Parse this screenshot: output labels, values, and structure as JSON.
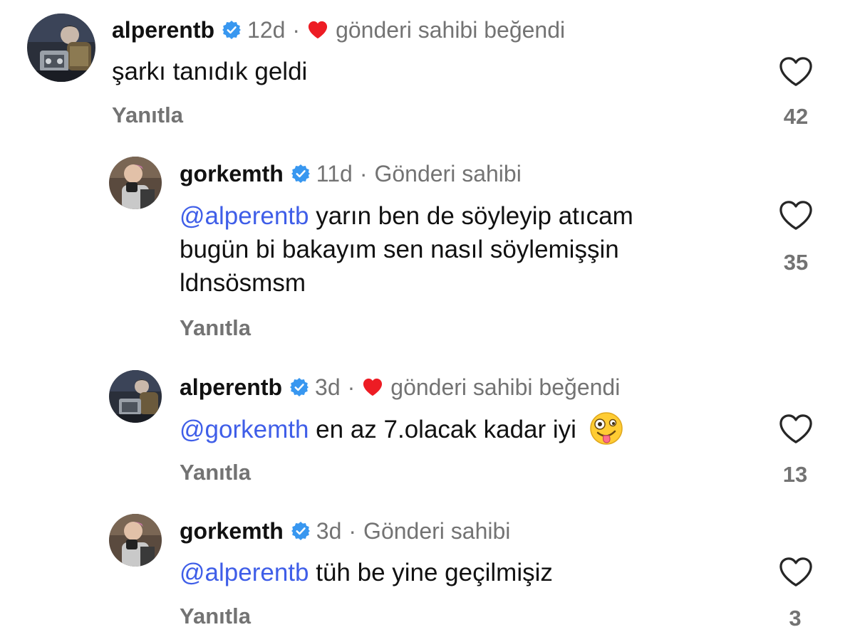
{
  "comments": [
    {
      "username": "alperentb",
      "time": "12d",
      "tag": "gönderi sahibi beğendi",
      "mention": "",
      "text": "şarkı tanıdık geldi",
      "reply": "Yanıtla",
      "likes": "42"
    },
    {
      "username": "gorkemth",
      "time": "11d",
      "tag": "Gönderi sahibi",
      "mention": "@alperentb",
      "line1": "yarın ben de söyleyip atıcam",
      "line2": "bugün bi bakayım sen nasıl söylemişşin",
      "line3": "ldnsösmsm",
      "reply": "Yanıtla",
      "likes": "35"
    },
    {
      "username": "alperentb",
      "time": "3d",
      "tag": "gönderi sahibi beğendi",
      "mention": "@gorkemth",
      "text": "en az 7.olacak kadar iyi",
      "emoji": "zany-face",
      "reply": "Yanıtla",
      "likes": "13"
    },
    {
      "username": "gorkemth",
      "time": "3d",
      "tag": "Gönderi sahibi",
      "mention": "@alperentb",
      "text": "tüh be yine geçilmişiz",
      "reply": "Yanıtla",
      "likes": "3"
    }
  ],
  "separator": "·",
  "colors": {
    "mention": "#3f5ee8",
    "verified": "#3897f0",
    "heart": "#ed1c24",
    "meta": "#737373"
  },
  "icons": {
    "verified": "verified-badge-icon",
    "liked_by_author": "red-heart-icon",
    "like": "heart-outline-icon"
  }
}
